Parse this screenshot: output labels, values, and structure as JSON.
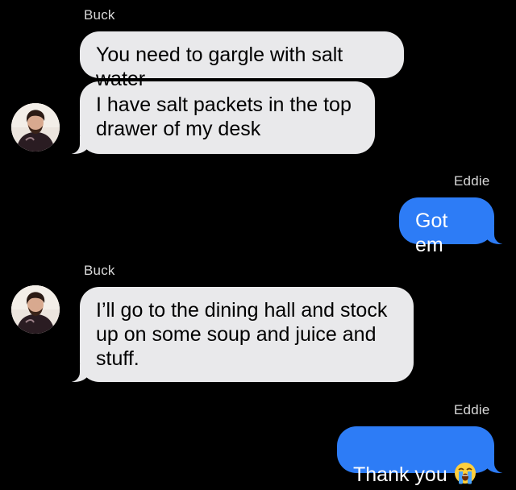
{
  "conversation": {
    "messages": [
      {
        "sender": "Buck",
        "text": "You need to gargle with salt water"
      },
      {
        "sender": "Buck",
        "text": "I have salt packets in the top\ndrawer of my desk"
      },
      {
        "sender": "Eddie",
        "text": "Got em"
      },
      {
        "sender": "Buck",
        "text": "I’ll go to the dining hall and stock\nup on some soup and juice and\nstuff."
      },
      {
        "sender": "Eddie",
        "text": "Thank you"
      }
    ],
    "emoji": "loudly-crying-face-icon"
  },
  "colors": {
    "background": "#000000",
    "incoming_bubble": "#e9e9eb",
    "outgoing_bubble": "#2d7cf6",
    "sender_name": "#d8d8d8"
  }
}
